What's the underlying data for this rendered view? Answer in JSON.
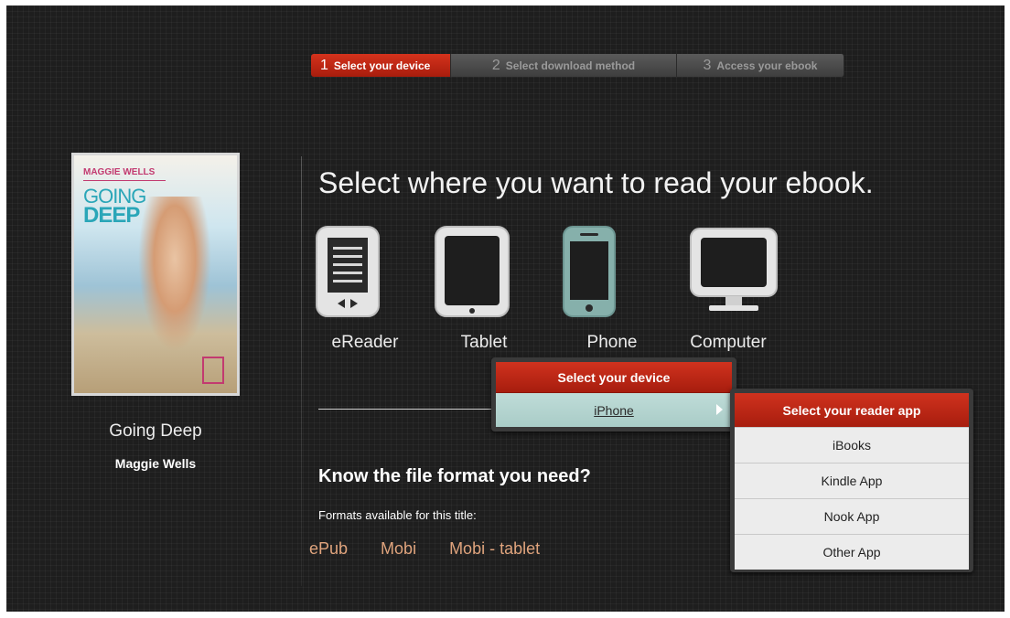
{
  "steps": [
    {
      "num": "1",
      "label": "Select your device"
    },
    {
      "num": "2",
      "label": "Select download method"
    },
    {
      "num": "3",
      "label": "Access your ebook"
    }
  ],
  "book": {
    "cover_author": "MAGGIE WELLS",
    "cover_title_line1": "GOING",
    "cover_title_line2": "DEEP",
    "title": "Going Deep",
    "author": "Maggie Wells"
  },
  "headline": "Select where you want to read your ebook.",
  "devices": [
    {
      "label": "eReader",
      "icon": "ereader-icon"
    },
    {
      "label": "Tablet",
      "icon": "tablet-icon"
    },
    {
      "label": "Phone",
      "icon": "phone-icon"
    },
    {
      "label": "Computer",
      "icon": "computer-icon"
    }
  ],
  "device_popup": {
    "title": "Select your device",
    "selected": "iPhone"
  },
  "app_popup": {
    "title": "Select your reader app",
    "items": [
      "iBooks",
      "Kindle App",
      "Nook App",
      "Other App"
    ]
  },
  "formats": {
    "title": "Know the file format you need?",
    "subtitle": "Formats available for this title:",
    "items": [
      "ePub",
      "Mobi",
      "Mobi - tablet"
    ]
  },
  "colors": {
    "accent_red": "#c0281a",
    "phone_teal": "#7fa9a4",
    "format_link": "#e0a47d"
  }
}
